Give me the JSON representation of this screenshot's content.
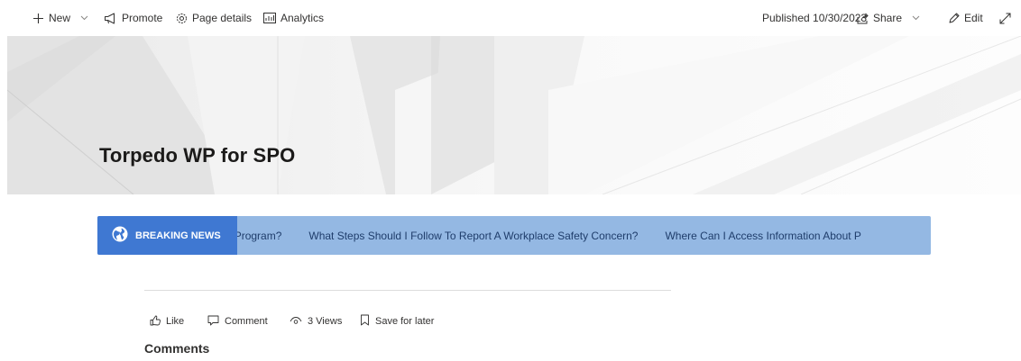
{
  "command_bar": {
    "new_label": "New",
    "promote_label": "Promote",
    "page_details_label": "Page details",
    "analytics_label": "Analytics",
    "published_label": "Published 10/30/2023",
    "share_label": "Share",
    "edit_label": "Edit"
  },
  "hero": {
    "title": "Torpedo WP for SPO"
  },
  "breaking_news": {
    "badge_label": "BREAKING NEWS",
    "items": [
      "ellness Program?",
      "What Steps Should I Follow To Report A Workplace Safety Concern?",
      "Where Can I Access Information About P"
    ],
    "colors": {
      "badge": "#3f78d2",
      "bar": "#94b8e3"
    }
  },
  "social": {
    "like_label": "Like",
    "comment_label": "Comment",
    "views_label": "3 Views",
    "save_label": "Save for later"
  },
  "comments": {
    "title": "Comments"
  }
}
